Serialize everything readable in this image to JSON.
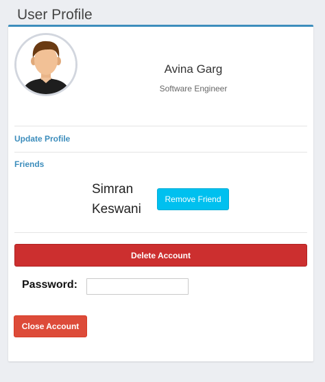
{
  "page": {
    "title": "User Profile"
  },
  "profile": {
    "name": "Avina Garg",
    "role": "Software Engineer",
    "avatar_icon": "user-avatar-icon"
  },
  "links": {
    "update_profile": "Update Profile",
    "friends": "Friends"
  },
  "friend": {
    "name": "Simran Keswani",
    "remove_label": "Remove Friend"
  },
  "account": {
    "delete_label": "Delete Account",
    "password_label": "Password:",
    "password_value": "",
    "close_label": "Close Account"
  },
  "colors": {
    "accent": "#3c8dbc",
    "info": "#00c0ef",
    "danger": "#cc2f2f",
    "danger_light": "#dd4b39"
  }
}
